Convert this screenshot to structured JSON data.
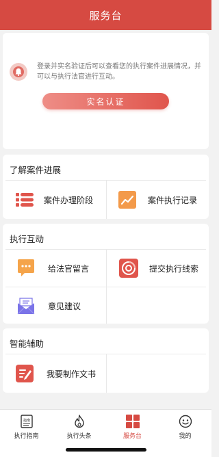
{
  "header": {
    "title": "服务台"
  },
  "auth": {
    "notice": "登录并实名验证后可以查看您的执行案件进展情况，并可以与执行法官进行互动。",
    "button_label": "实名认证",
    "icon": "bell-icon"
  },
  "sections": {
    "progress": {
      "title": "了解案件进展",
      "items": [
        {
          "label": "案件办理阶段",
          "icon": "stages-icon"
        },
        {
          "label": "案件执行记录",
          "icon": "trend-chart-icon"
        }
      ]
    },
    "interaction": {
      "title": "执行互动",
      "items": [
        {
          "label": "给法官留言",
          "icon": "message-icon"
        },
        {
          "label": "提交执行线索",
          "icon": "clue-disc-icon"
        },
        {
          "label": "意见建议",
          "icon": "mail-icon"
        }
      ]
    },
    "assist": {
      "title": "智能辅助",
      "items": [
        {
          "label": "我要制作文书",
          "icon": "document-edit-icon"
        }
      ]
    }
  },
  "tabbar": {
    "items": [
      {
        "label": "执行指南",
        "icon": "guide-icon",
        "icon_text": "指南"
      },
      {
        "label": "执行头条",
        "icon": "flame-icon"
      },
      {
        "label": "服务台",
        "icon": "grid-icon",
        "active": true
      },
      {
        "label": "我的",
        "icon": "smiley-icon"
      }
    ]
  },
  "colors": {
    "brand_red": "#d64a42",
    "icon_orange": "#f08a3c",
    "icon_purple": "#7a73e8"
  }
}
